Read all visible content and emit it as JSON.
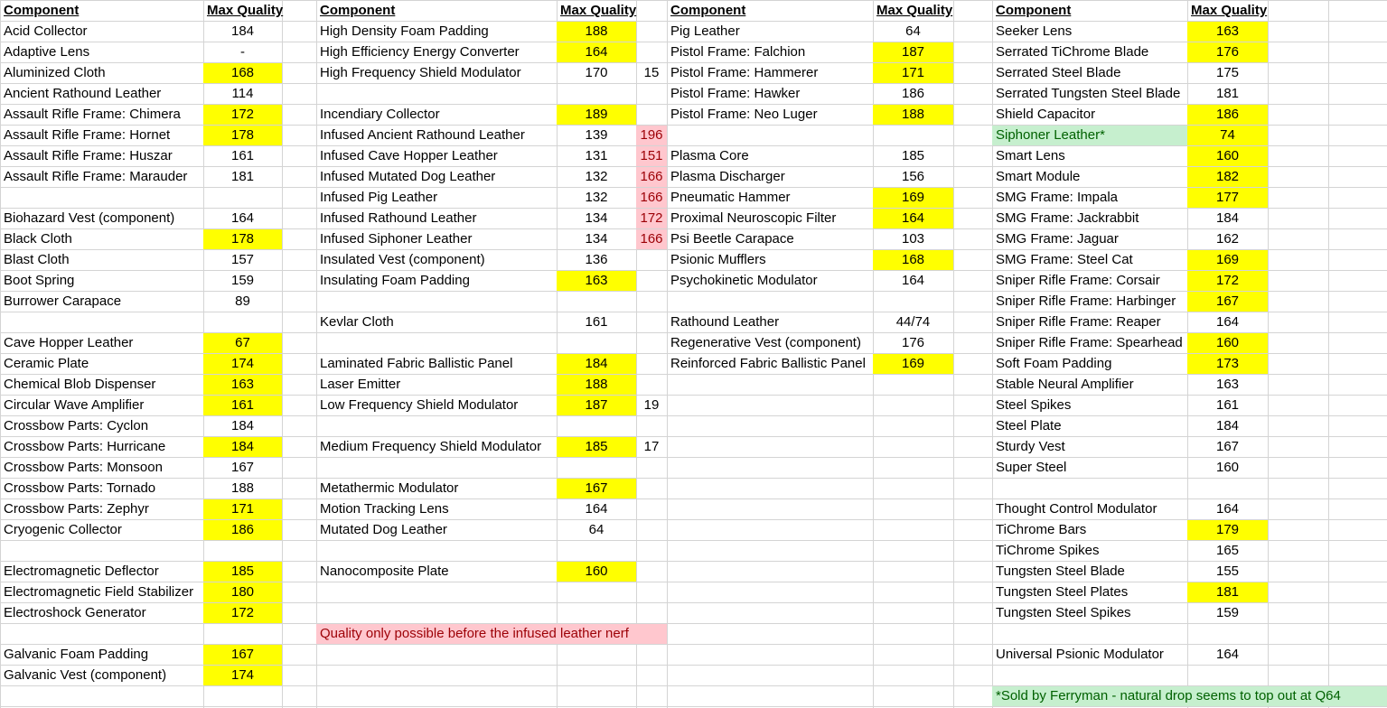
{
  "colors": {
    "highlight": "#ffff00",
    "pre_nerf": "#ffc7ce",
    "pre_nerf_text": "#9c0006",
    "vendor": "#c6efce",
    "vendor_text": "#006100"
  },
  "header": {
    "component": "Component",
    "max_quality": "Max Quality"
  },
  "columns": [
    {
      "rows": [
        {
          "name": "Acid Collector",
          "quality": "184"
        },
        {
          "name": "Adaptive Lens",
          "quality": "-"
        },
        {
          "name": "Aluminized Cloth",
          "quality": "168",
          "highlight": true
        },
        {
          "name": "Ancient Rathound Leather",
          "quality": "114"
        },
        {
          "name": "Assault Rifle Frame: Chimera",
          "quality": "172",
          "highlight": true
        },
        {
          "name": "Assault Rifle Frame: Hornet",
          "quality": "178",
          "highlight": true
        },
        {
          "name": "Assault Rifle Frame: Huszar",
          "quality": "161"
        },
        {
          "name": "Assault Rifle Frame: Marauder",
          "quality": "181"
        },
        {
          "name": "",
          "quality": ""
        },
        {
          "name": "Biohazard Vest (component)",
          "quality": "164"
        },
        {
          "name": "Black Cloth",
          "quality": "178",
          "highlight": true
        },
        {
          "name": "Blast Cloth",
          "quality": "157"
        },
        {
          "name": "Boot Spring",
          "quality": "159"
        },
        {
          "name": "Burrower Carapace",
          "quality": "89"
        },
        {
          "name": "",
          "quality": ""
        },
        {
          "name": "Cave Hopper Leather",
          "quality": "67",
          "highlight": true
        },
        {
          "name": "Ceramic Plate",
          "quality": "174",
          "highlight": true
        },
        {
          "name": "Chemical Blob Dispenser",
          "quality": "163",
          "highlight": true
        },
        {
          "name": "Circular Wave Amplifier",
          "quality": "161",
          "highlight": true
        },
        {
          "name": "Crossbow Parts: Cyclon",
          "quality": "184"
        },
        {
          "name": "Crossbow Parts: Hurricane",
          "quality": "184",
          "highlight": true
        },
        {
          "name": "Crossbow Parts: Monsoon",
          "quality": "167"
        },
        {
          "name": "Crossbow Parts: Tornado",
          "quality": "188"
        },
        {
          "name": "Crossbow Parts: Zephyr",
          "quality": "171",
          "highlight": true
        },
        {
          "name": "Cryogenic Collector",
          "quality": "186",
          "highlight": true
        },
        {
          "name": "",
          "quality": ""
        },
        {
          "name": "Electromagnetic Deflector",
          "quality": "185",
          "highlight": true
        },
        {
          "name": "Electromagnetic Field Stabilizer",
          "quality": "180",
          "highlight": true
        },
        {
          "name": "Electroshock Generator",
          "quality": "172",
          "highlight": true
        },
        {
          "name": "",
          "quality": ""
        },
        {
          "name": "Galvanic Foam Padding",
          "quality": "167",
          "highlight": true
        },
        {
          "name": "Galvanic Vest (component)",
          "quality": "174",
          "highlight": true
        }
      ]
    },
    {
      "rows": [
        {
          "name": "High Density Foam Padding",
          "quality": "188",
          "highlight": true,
          "extra": ""
        },
        {
          "name": "High Efficiency Energy Converter",
          "quality": "164",
          "highlight": true,
          "extra": ""
        },
        {
          "name": "High Frequency Shield Modulator",
          "quality": "170",
          "extra": "15"
        },
        {
          "name": "",
          "quality": "",
          "extra": ""
        },
        {
          "name": "Incendiary Collector",
          "quality": "189",
          "highlight": true,
          "extra": ""
        },
        {
          "name": "Infused Ancient Rathound Leather",
          "quality": "139",
          "extra": "196",
          "extra_pink": true
        },
        {
          "name": "Infused Cave Hopper Leather",
          "quality": "131",
          "extra": "151",
          "extra_pink": true
        },
        {
          "name": "Infused Mutated Dog Leather",
          "quality": "132",
          "extra": "166",
          "extra_pink": true
        },
        {
          "name": "Infused Pig Leather",
          "quality": "132",
          "extra": "166",
          "extra_pink": true
        },
        {
          "name": "Infused Rathound Leather",
          "quality": "134",
          "extra": "172",
          "extra_pink": true
        },
        {
          "name": "Infused Siphoner Leather",
          "quality": "134",
          "extra": "166",
          "extra_pink": true
        },
        {
          "name": "Insulated Vest (component)",
          "quality": "136",
          "extra": ""
        },
        {
          "name": "Insulating Foam Padding",
          "quality": "163",
          "highlight": true,
          "extra": ""
        },
        {
          "name": "",
          "quality": "",
          "extra": ""
        },
        {
          "name": "Kevlar Cloth",
          "quality": "161",
          "extra": ""
        },
        {
          "name": "",
          "quality": "",
          "extra": ""
        },
        {
          "name": "Laminated Fabric Ballistic Panel",
          "quality": "184",
          "highlight": true,
          "extra": ""
        },
        {
          "name": "Laser Emitter",
          "quality": "188",
          "highlight": true,
          "extra": ""
        },
        {
          "name": "Low Frequency Shield Modulator",
          "quality": "187",
          "highlight": true,
          "extra": "19"
        },
        {
          "name": "",
          "quality": "",
          "extra": ""
        },
        {
          "name": "Medium Frequency Shield Modulator",
          "quality": "185",
          "highlight": true,
          "extra": "17"
        },
        {
          "name": "",
          "quality": "",
          "extra": ""
        },
        {
          "name": "Metathermic Modulator",
          "quality": "167",
          "highlight": true,
          "extra": ""
        },
        {
          "name": "Motion Tracking Lens",
          "quality": "164",
          "extra": ""
        },
        {
          "name": "Mutated Dog Leather",
          "quality": "64",
          "extra": ""
        },
        {
          "name": "",
          "quality": "",
          "extra": ""
        },
        {
          "name": "Nanocomposite Plate",
          "quality": "160",
          "highlight": true,
          "extra": ""
        },
        {
          "name": "",
          "quality": "",
          "extra": ""
        },
        {
          "name": "",
          "quality": "",
          "extra": ""
        },
        {
          "name": "Quality only possible before the infused leather nerf",
          "quality": "",
          "extra": "",
          "note_pink": true
        },
        {
          "name": "",
          "quality": "",
          "extra": ""
        },
        {
          "name": "",
          "quality": "",
          "extra": ""
        }
      ]
    },
    {
      "rows": [
        {
          "name": "Pig Leather",
          "quality": "64"
        },
        {
          "name": "Pistol Frame: Falchion",
          "quality": "187",
          "highlight": true
        },
        {
          "name": "Pistol Frame: Hammerer",
          "quality": "171",
          "highlight": true
        },
        {
          "name": "Pistol Frame: Hawker",
          "quality": "186"
        },
        {
          "name": "Pistol Frame: Neo Luger",
          "quality": "188",
          "highlight": true
        },
        {
          "name": "",
          "quality": ""
        },
        {
          "name": "Plasma Core",
          "quality": "185"
        },
        {
          "name": "Plasma Discharger",
          "quality": "156"
        },
        {
          "name": "Pneumatic Hammer",
          "quality": "169",
          "highlight": true
        },
        {
          "name": "Proximal Neuroscopic Filter",
          "quality": "164",
          "highlight": true
        },
        {
          "name": "Psi Beetle Carapace",
          "quality": "103"
        },
        {
          "name": "Psionic Mufflers",
          "quality": "168",
          "highlight": true
        },
        {
          "name": "Psychokinetic Modulator",
          "quality": "164"
        },
        {
          "name": "",
          "quality": ""
        },
        {
          "name": "Rathound Leather",
          "quality": "44/74"
        },
        {
          "name": "Regenerative Vest (component)",
          "quality": "176"
        },
        {
          "name": "Reinforced Fabric Ballistic Panel",
          "quality": "169",
          "highlight": true
        }
      ]
    },
    {
      "rows": [
        {
          "name": "Seeker Lens",
          "quality": "163",
          "highlight": true
        },
        {
          "name": "Serrated TiChrome Blade",
          "quality": "176",
          "highlight": true
        },
        {
          "name": "Serrated Steel Blade",
          "quality": "175"
        },
        {
          "name": "Serrated Tungsten Steel Blade",
          "quality": "181"
        },
        {
          "name": "Shield Capacitor",
          "quality": "186",
          "highlight": true
        },
        {
          "name": "Siphoner Leather*",
          "quality": "74",
          "highlight": true,
          "name_green": true
        },
        {
          "name": "Smart Lens",
          "quality": "160",
          "highlight": true
        },
        {
          "name": "Smart Module",
          "quality": "182",
          "highlight": true
        },
        {
          "name": "SMG Frame: Impala",
          "quality": "177",
          "highlight": true
        },
        {
          "name": "SMG Frame: Jackrabbit",
          "quality": "184"
        },
        {
          "name": "SMG Frame: Jaguar",
          "quality": "162"
        },
        {
          "name": "SMG Frame: Steel Cat",
          "quality": "169",
          "highlight": true
        },
        {
          "name": "Sniper Rifle Frame: Corsair",
          "quality": "172",
          "highlight": true
        },
        {
          "name": "Sniper Rifle Frame: Harbinger",
          "quality": "167",
          "highlight": true
        },
        {
          "name": "Sniper Rifle Frame: Reaper",
          "quality": "164"
        },
        {
          "name": "Sniper Rifle Frame: Spearhead",
          "quality": "160",
          "highlight": true
        },
        {
          "name": "Soft Foam Padding",
          "quality": "173",
          "highlight": true
        },
        {
          "name": "Stable Neural Amplifier",
          "quality": "163"
        },
        {
          "name": "Steel Spikes",
          "quality": "161"
        },
        {
          "name": "Steel Plate",
          "quality": "184"
        },
        {
          "name": "Sturdy Vest",
          "quality": "167"
        },
        {
          "name": "Super Steel",
          "quality": "160"
        },
        {
          "name": "",
          "quality": ""
        },
        {
          "name": "Thought Control Modulator",
          "quality": "164"
        },
        {
          "name": "TiChrome Bars",
          "quality": "179",
          "highlight": true
        },
        {
          "name": "TiChrome Spikes",
          "quality": "165"
        },
        {
          "name": "Tungsten Steel Blade",
          "quality": "155"
        },
        {
          "name": "Tungsten Steel Plates",
          "quality": "181",
          "highlight": true
        },
        {
          "name": "Tungsten Steel Spikes",
          "quality": "159"
        },
        {
          "name": "",
          "quality": ""
        },
        {
          "name": "Universal Psionic Modulator",
          "quality": "164"
        },
        {
          "name": "",
          "quality": ""
        },
        {
          "name": "*Sold by Ferryman - natural drop seems to top out at Q64",
          "quality": "",
          "note_green": true
        }
      ]
    }
  ]
}
